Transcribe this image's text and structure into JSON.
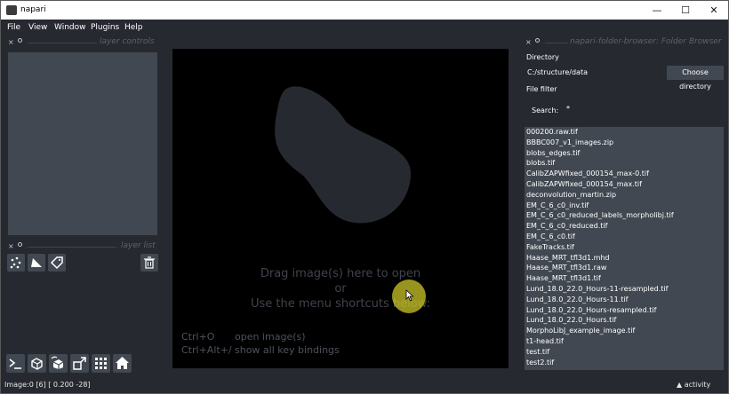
{
  "window": {
    "title": "napari",
    "minimize": "—",
    "maximize": "☐",
    "close": "✕"
  },
  "menu": [
    "File",
    "View",
    "Window",
    "Plugins",
    "Help"
  ],
  "left_dock": {
    "controls_title": "layer controls",
    "list_title": "layer list",
    "close_glyph": "×"
  },
  "layer_buttons": [
    {
      "icon": "new-points-icon"
    },
    {
      "icon": "new-shapes-icon"
    },
    {
      "icon": "new-labels-icon"
    },
    {
      "icon": "delete-layer-icon"
    }
  ],
  "bottom_buttons": [
    {
      "icon": "console-icon"
    },
    {
      "icon": "ndisplay-3d-icon"
    },
    {
      "icon": "roll-dims-icon"
    },
    {
      "icon": "transpose-icon"
    },
    {
      "icon": "grid-icon"
    },
    {
      "icon": "home-icon"
    }
  ],
  "canvas": {
    "welcome_line1": "Drag image(s) here to open",
    "welcome_line2": "or",
    "welcome_line3": "Use the menu shortcuts below:",
    "shortcuts": [
      {
        "keys": "Ctrl+O",
        "desc": "open image(s)"
      },
      {
        "keys": "Ctrl+Alt+/",
        "desc": "show all key bindings"
      }
    ]
  },
  "folder_browser": {
    "title": "napari-folder-browser: Folder Browser",
    "directory_label": "Directory",
    "directory_value": "C:/structure/data",
    "choose_button": "Choose directory",
    "file_filter_label": "File filter",
    "search_label": "Search:",
    "search_value": "*",
    "files": [
      "000200.raw.tif",
      "BBBC007_v1_images.zip",
      "blobs_edges.tif",
      "blobs.tif",
      "CalibZAPWfixed_000154_max-0.tif",
      "CalibZAPWfixed_000154_max.tif",
      "deconvolution_martin.zip",
      "EM_C_6_c0_inv.tif",
      "EM_C_6_c0_reduced_labels_morpholibj.tif",
      "EM_C_6_c0_reduced.tif",
      "EM_C_6_c0.tif",
      "FakeTracks.tif",
      "Haase_MRT_tfl3d1.mhd",
      "Haase_MRT_tfl3d1.raw",
      "Haase_MRT_tfl3d1.tif",
      "Lund_18.0_22.0_Hours-11-resampled.tif",
      "Lund_18.0_22.0_Hours-11.tif",
      "Lund_18.0_22.0_Hours-resampled.tif",
      "Lund_18.0_22.0_Hours.tif",
      "MorphoLibJ_example_image.tif",
      "t1-head.tif",
      "test.tif",
      "test2.tif"
    ]
  },
  "status": {
    "text": "Image:0 [6] [  0.200 -28]",
    "activity": "▲ activity"
  },
  "colors": {
    "background": "#262930",
    "panel": "#414851",
    "canvas": "#000000",
    "text": "#ffffff",
    "muted": "#5c6271"
  }
}
